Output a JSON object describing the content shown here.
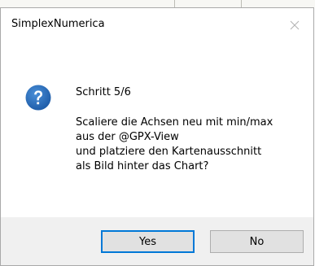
{
  "dialog": {
    "title": "SimplexNumerica",
    "close_icon": "close-icon",
    "icon": "question-icon",
    "accent_color": "#0078d7",
    "step": "Schritt 5/6",
    "message_lines": [
      "Scaliere die Achsen neu mit min/max",
      "aus der @GPX-View",
      "und platziere den Kartenausschnitt",
      "als Bild hinter das Chart?"
    ],
    "buttons": {
      "yes_label": "Yes",
      "no_label": "No"
    }
  }
}
